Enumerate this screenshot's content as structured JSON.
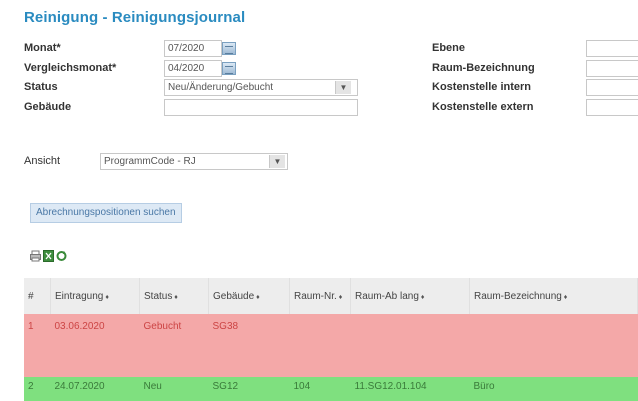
{
  "title": "Reinigung - Reinigungsjournal",
  "form": {
    "monat_label": "Monat*",
    "monat_value": "07/2020",
    "vergleich_label": "Vergleichsmonat*",
    "vergleich_value": "04/2020",
    "status_label": "Status",
    "status_value": "Neu/Änderung/Gebucht",
    "gebaeude_label": "Gebäude",
    "gebaeude_value": "",
    "ebene_label": "Ebene",
    "raum_bez_label": "Raum-Bezeichnung",
    "kst_intern_label": "Kostenstelle intern",
    "kst_extern_label": "Kostenstelle extern",
    "ansicht_label": "Ansicht",
    "ansicht_value": "ProgrammCode - RJ"
  },
  "search_button": "Abrechnungspositionen suchen",
  "icons": [
    "printer-icon",
    "excel-icon",
    "refresh-icon"
  ],
  "table": {
    "columns": [
      "#",
      "Eintragung",
      "Status",
      "Gebäude",
      "Raum-Nr.",
      "Raum-Ab lang",
      "Raum-Bezeichnung"
    ],
    "rows": [
      {
        "num": "1",
        "date": "03.06.2020",
        "status": "Gebucht",
        "building": "SG38",
        "raum_nr": "",
        "raum_lang": "",
        "raum_bez": "",
        "color": "#f4a8a8"
      },
      {
        "num": "2",
        "date": "24.07.2020",
        "status": "Neu",
        "building": "SG12",
        "raum_nr": "104",
        "raum_lang": "11.SG12.01.104",
        "raum_bez": "Büro",
        "color": "#7fe07f"
      }
    ]
  }
}
